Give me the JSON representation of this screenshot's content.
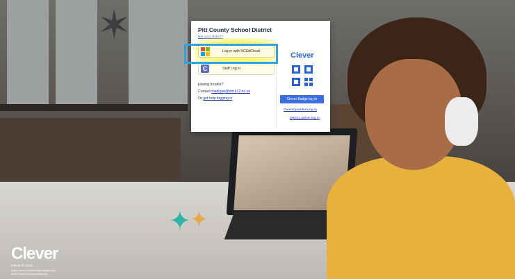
{
  "card": {
    "district_name": "Pitt County School District",
    "not_district": "Not your district?",
    "login_ncedcloud": "Log in with NCEdCloud",
    "staff_login": "Staff Log in",
    "trouble": "Having trouble?",
    "contact_prefix": "Contact ",
    "contact_email": "madigab@pitt.k12.nc.us",
    "or_prefix": "Or ",
    "help_link": "get help logging in",
    "clever_word": "Clever",
    "badge_login": "Clever Badge log in",
    "parent_login": "Parent/guardian log in",
    "admin_login": "District admin log in"
  },
  "footer": {
    "logo": "Clever",
    "copyright": "Clever © 2022",
    "privacy_link": "https://clever.com/trust/privacy/policy",
    "terms_link": "https://clever.com/about/terms"
  },
  "colors": {
    "clever_blue": "#2963d9",
    "focus_ring": "#2fa3e0",
    "highlight_yellow": "#fff550"
  }
}
